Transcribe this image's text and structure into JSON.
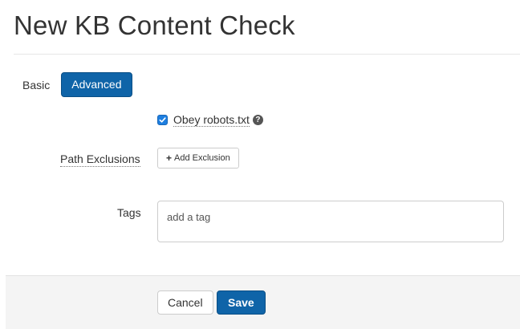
{
  "page": {
    "title": "New KB Content Check"
  },
  "mode_toggle": {
    "basic_label": "Basic",
    "advanced_label": "Advanced",
    "selected": "Advanced"
  },
  "options": {
    "obey_robots_label": "Obey robots.txt",
    "obey_robots_checked": true,
    "help_icon": "question-circle-icon"
  },
  "path_exclusions": {
    "label": "Path Exclusions",
    "add_button_label": "Add Exclusion",
    "add_icon": "plus-icon"
  },
  "tags": {
    "label": "Tags",
    "placeholder": "add a tag"
  },
  "footer": {
    "cancel_label": "Cancel",
    "save_label": "Save"
  },
  "colors": {
    "primary": "#0f64a8",
    "checkbox": "#1e7fe0",
    "footer_bg": "#f4f4f4"
  }
}
